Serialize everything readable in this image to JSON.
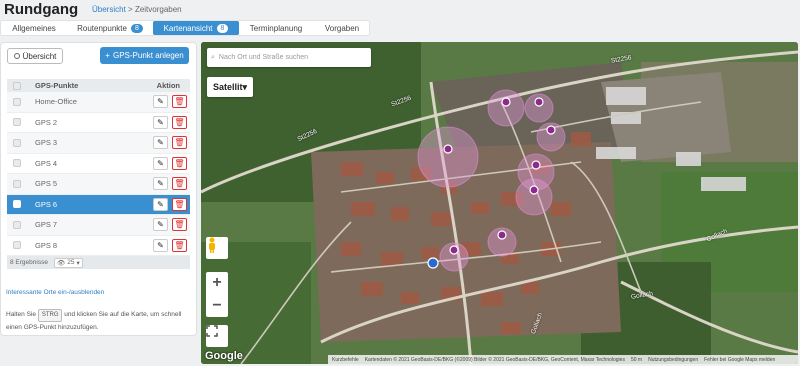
{
  "header": {
    "title": "Rundgang",
    "crumb_link": "Übersicht",
    "crumb_sep": ">",
    "crumb_current": "Zeitvorgaben"
  },
  "tabs": [
    {
      "label": "Allgemeines"
    },
    {
      "label": "Routenpunkte",
      "badge": "8"
    },
    {
      "label": "Kartenansicht",
      "badge": "8"
    },
    {
      "label": "Terminplanung"
    },
    {
      "label": "Vorgaben"
    }
  ],
  "panel": {
    "overview_label": "Übersicht",
    "add_label": "GPS-Punkt anlegen",
    "col_name": "GPS-Punkte",
    "col_action": "Aktion",
    "rows": [
      {
        "name": "Home-Office"
      },
      {
        "name": "GPS 2"
      },
      {
        "name": "GPS 3"
      },
      {
        "name": "GPS 4"
      },
      {
        "name": "GPS 5"
      },
      {
        "name": "GPS 6"
      },
      {
        "name": "GPS 7"
      },
      {
        "name": "GPS 8"
      }
    ],
    "result_count": "8 Ergebnisse",
    "page_size": "25",
    "poi_link": "Interessante Orte ein-/ausblenden",
    "hint_pre": "Halten Sie",
    "hint_key": "STRG",
    "hint_post": "und klicken Sie auf die Karte, um schnell einen GPS-Punkt hinzuzufügen."
  },
  "map": {
    "search_placeholder": "Nach Ort und Straße suchen",
    "maptype": "Satellit",
    "google": "Google",
    "roads": [
      "St2256",
      "St2256",
      "St2256",
      "Gollach",
      "Gollach",
      "Gollach"
    ],
    "attrib": [
      "Kurzbefehle",
      "Kartendaten © 2021 GeoBasis-DE/BKG (©2009) Bilder © 2021 GeoBasis-DE/BKG, GeoContent, Maxar Technologies",
      "50 m",
      "Nutzungsbedingungen",
      "Fehler bei Google Maps melden"
    ]
  }
}
